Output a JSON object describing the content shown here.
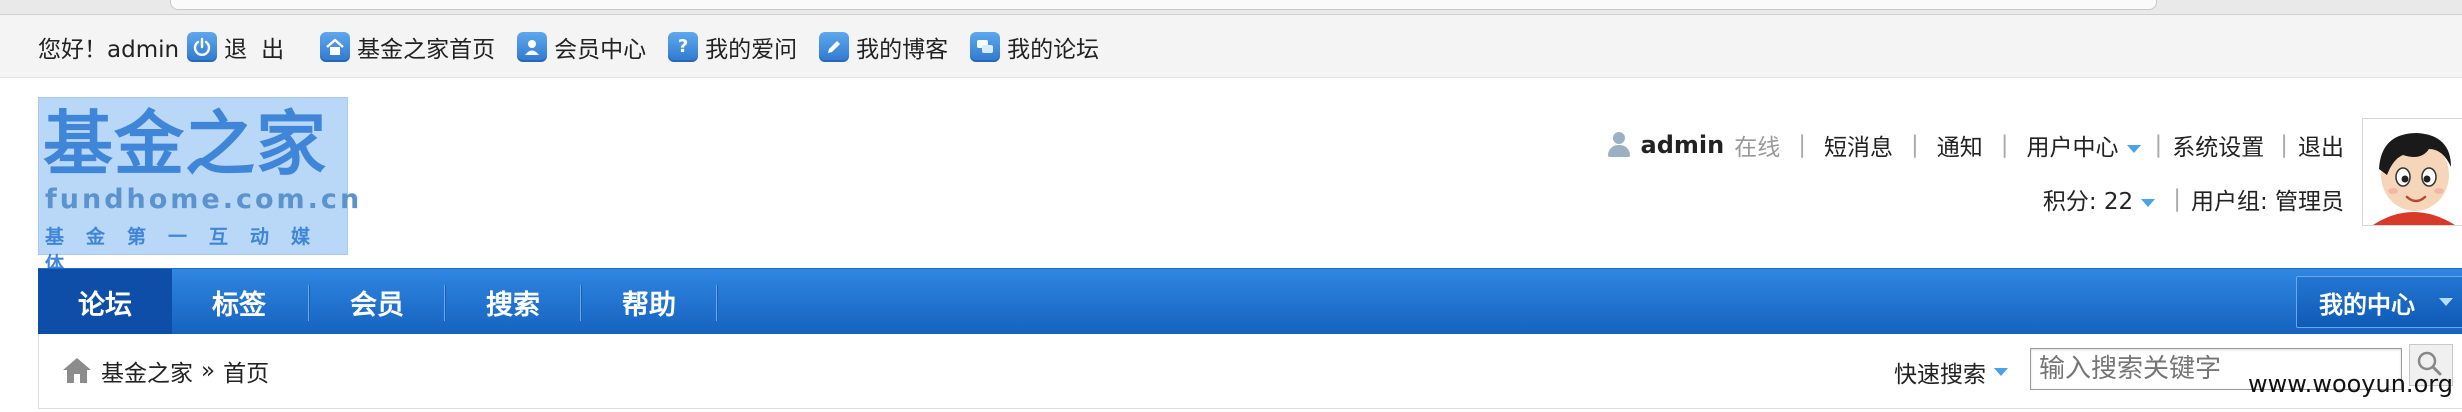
{
  "topbar": {
    "greeting": "您好！admin",
    "items": [
      {
        "label": "退出",
        "icon": "power-icon"
      },
      {
        "label": "基金之家首页",
        "icon": "home-icon"
      },
      {
        "label": "会员中心",
        "icon": "member-icon"
      },
      {
        "label": "我的爱问",
        "icon": "question-icon"
      },
      {
        "label": "我的博客",
        "icon": "blog-pencil-icon"
      },
      {
        "label": "我的论坛",
        "icon": "forum-icon"
      }
    ]
  },
  "logo": {
    "title": "基金之家",
    "url": "fundhome.com.cn",
    "slogan": "基金第一互动媒体"
  },
  "user": {
    "name": "admin",
    "status": "在线",
    "links": [
      "短消息",
      "通知",
      "用户中心",
      "系统设置",
      "退出"
    ],
    "points": "积分: 22",
    "group": "用户组: 管理员"
  },
  "nav": {
    "items": [
      "论坛",
      "标签",
      "会员",
      "搜索",
      "帮助"
    ],
    "active_index": 0,
    "my_center": "我的中心"
  },
  "breadcrumb": {
    "site": "基金之家",
    "separator": "»",
    "page": "首页"
  },
  "search": {
    "label": "快速搜索",
    "placeholder": "输入搜索关键字"
  },
  "watermark": "www.wooyun.org",
  "colors": {
    "nav_blue": "#1e70cf",
    "nav_active": "#0f4ea8",
    "logo_bg": "#b9d7f6",
    "logo_text": "#3f86d8",
    "caret": "#4aa3e6"
  }
}
